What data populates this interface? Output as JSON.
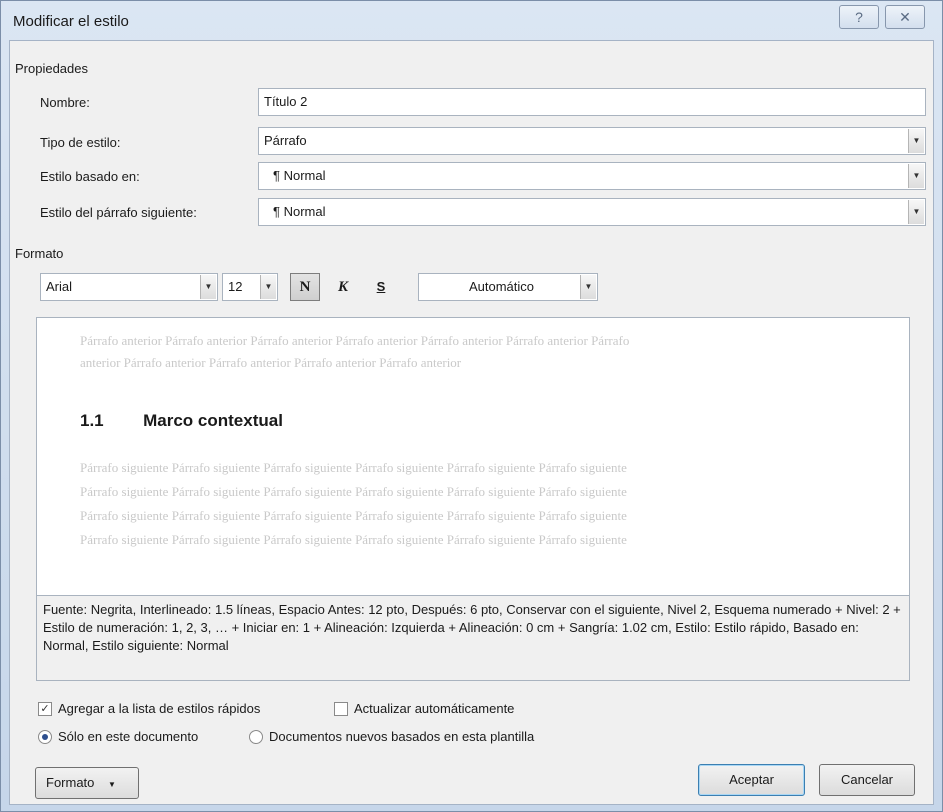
{
  "dialog": {
    "title": "Modificar el estilo",
    "help_icon": "?",
    "close_icon": "✕"
  },
  "properties": {
    "section_label": "Propiedades",
    "name_label": "Nombre:",
    "name_value": "Título 2",
    "style_type_label": "Tipo de estilo:",
    "style_type_value": "Párrafo",
    "based_on_label": "Estilo basado en:",
    "based_on_value": "¶ Normal",
    "next_style_label": "Estilo del párrafo siguiente:",
    "next_style_value": "¶ Normal"
  },
  "format": {
    "section_label": "Formato",
    "font_value": "Arial",
    "size_value": "12",
    "bold_label": "N",
    "italic_label": "K",
    "underline_label": "S",
    "color_value": "Automático"
  },
  "preview": {
    "prev_line1": "Párrafo anterior Párrafo anterior Párrafo anterior Párrafo anterior Párrafo anterior Párrafo anterior Párrafo",
    "prev_line2": "anterior Párrafo anterior Párrafo anterior Párrafo anterior Párrafo anterior",
    "heading_number": "1.1",
    "heading_text": "Marco contextual",
    "next_line1": "Párrafo siguiente Párrafo siguiente Párrafo siguiente Párrafo siguiente Párrafo siguiente Párrafo siguiente",
    "next_line2": "Párrafo siguiente Párrafo siguiente Párrafo siguiente Párrafo siguiente Párrafo siguiente Párrafo siguiente",
    "next_line3": "Párrafo siguiente Párrafo siguiente Párrafo siguiente Párrafo siguiente Párrafo siguiente Párrafo siguiente",
    "next_line4": "Párrafo siguiente Párrafo siguiente Párrafo siguiente Párrafo siguiente Párrafo siguiente Párrafo siguiente"
  },
  "description": "Fuente: Negrita, Interlineado:  1.5 líneas, Espacio Antes:  12 pto, Después:  6 pto, Conservar con el siguiente, Nivel 2, Esquema numerado + Nivel: 2 + Estilo de numeración: 1, 2, 3, … + Iniciar en: 1 + Alineación: Izquierda + Alineación:  0 cm + Sangría:  1.02 cm, Estilo: Estilo rápido, Basado en: Normal, Estilo siguiente: Normal",
  "options": {
    "add_quick_styles": "Agregar a la lista de estilos rápidos",
    "add_quick_styles_checked": true,
    "auto_update": "Actualizar automáticamente",
    "auto_update_checked": false,
    "only_this_doc": "Sólo en este documento",
    "new_docs_template": "Documentos nuevos basados en esta plantilla"
  },
  "buttons": {
    "format": "Formato",
    "accept": "Aceptar",
    "cancel": "Cancelar"
  }
}
